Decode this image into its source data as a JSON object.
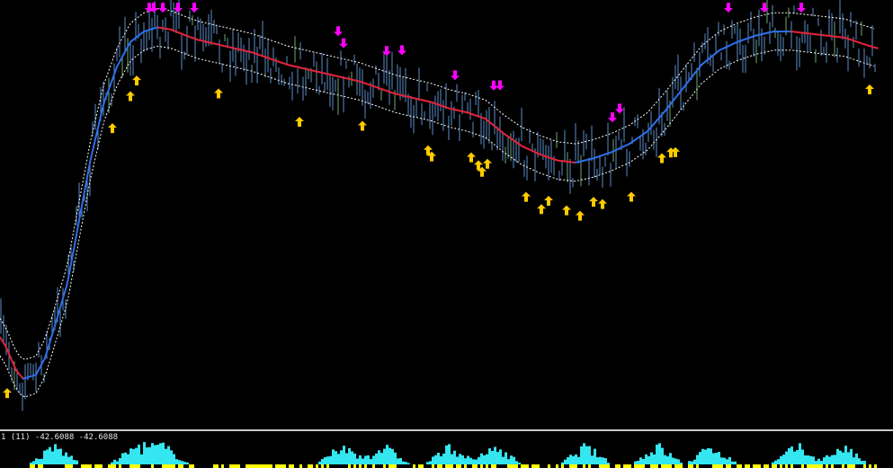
{
  "subwindow": {
    "label": "1 (11) -42.6088 -42.6088"
  },
  "colors": {
    "background": "#000000",
    "price_bars": "#5b8ec9",
    "price_bars_bull": "#6fa86f",
    "ma_up": "#2f6fe8",
    "ma_down": "#e0243a",
    "band": "#ffffff",
    "buy_arrow": "#ffcc00",
    "sell_arrow": "#ff00ff",
    "hist_pos": "#33e6f0",
    "hist_neg": "#ffff00",
    "separator": "#c8c8c8"
  },
  "chart_data": [
    {
      "type": "line",
      "title": "",
      "xlabel": "",
      "ylabel": "",
      "y_axis_visible": false,
      "grid": false,
      "bar_count": 320,
      "series": [
        {
          "role": "moving-average",
          "x": [
            0,
            6,
            12,
            18,
            26,
            40,
            50,
            60,
            75,
            100,
            115,
            130,
            145,
            160,
            175,
            190,
            205,
            220,
            240,
            260,
            280,
            300,
            320,
            340,
            360,
            380,
            400,
            420,
            440,
            460,
            480,
            500,
            520,
            540,
            560,
            580,
            600,
            620,
            640,
            660,
            680,
            700,
            720,
            740,
            760,
            780,
            800,
            820,
            840,
            860,
            880,
            900,
            920,
            940,
            960,
            975
          ],
          "values": [
            0.2,
            0.18,
            0.15,
            0.12,
            0.1,
            0.11,
            0.15,
            0.22,
            0.33,
            0.62,
            0.76,
            0.85,
            0.91,
            0.935,
            0.945,
            0.94,
            0.927,
            0.915,
            0.905,
            0.895,
            0.885,
            0.87,
            0.855,
            0.845,
            0.835,
            0.825,
            0.815,
            0.8,
            0.785,
            0.775,
            0.765,
            0.75,
            0.74,
            0.725,
            0.69,
            0.66,
            0.64,
            0.625,
            0.62,
            0.63,
            0.645,
            0.665,
            0.695,
            0.745,
            0.8,
            0.855,
            0.89,
            0.91,
            0.925,
            0.935,
            0.935,
            0.93,
            0.925,
            0.92,
            0.905,
            0.895
          ]
        }
      ],
      "band_offset": 0.045,
      "buy_arrows_x": [
        8,
        125,
        145,
        152,
        243,
        333,
        403,
        476,
        480,
        524,
        532,
        536,
        542,
        585,
        602,
        610,
        630,
        645,
        660,
        670,
        702,
        736,
        746,
        751,
        967
      ],
      "sell_arrows_x": [
        166,
        171,
        181,
        198,
        216,
        376,
        382,
        430,
        447,
        506,
        549,
        556,
        681,
        689,
        810,
        850,
        891
      ]
    },
    {
      "type": "bar",
      "title": "",
      "series": [
        {
          "role": "histogram"
        }
      ],
      "bars_count": 320
    }
  ]
}
